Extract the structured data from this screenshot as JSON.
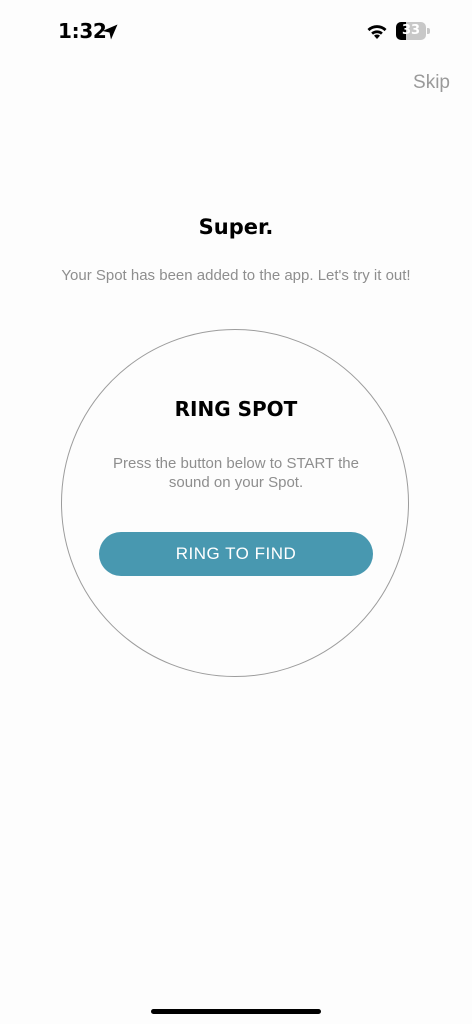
{
  "status_bar": {
    "time": "1:32",
    "battery_level": "33",
    "battery_fraction": 0.33,
    "icons": [
      "location-arrow-icon",
      "wifi-icon",
      "battery-icon"
    ]
  },
  "header": {
    "skip_label": "Skip"
  },
  "main": {
    "title": "Super.",
    "subtitle": "Your Spot has been added to the app. Let's try it out!",
    "circle": {
      "title": "RING SPOT",
      "description": "Press the button below to START the sound on your Spot.",
      "button_label": "RING TO FIND"
    }
  },
  "colors": {
    "accent": "#4898b0",
    "muted_text": "#8e8e8e",
    "background": "#fdfdfd"
  }
}
